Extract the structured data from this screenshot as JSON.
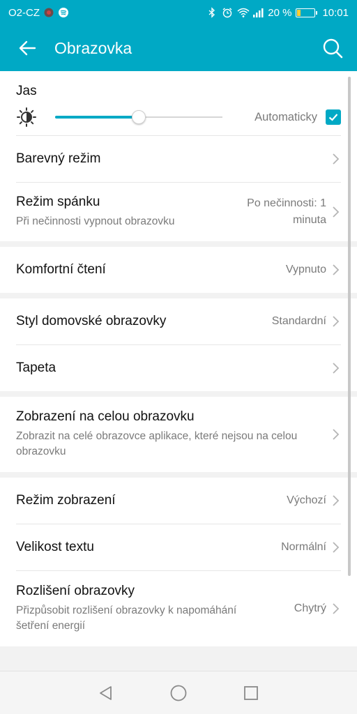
{
  "statusbar": {
    "carrier": "O2-CZ",
    "signal_text": "20 %",
    "time": "10:01",
    "battery_percent": 20
  },
  "appbar": {
    "title": "Obrazovka",
    "back_icon": "arrow-left-icon",
    "search_icon": "search-icon"
  },
  "brightness": {
    "title": "Jas",
    "level_percent": 50,
    "auto_label": "Automaticky",
    "auto_checked": true
  },
  "settings": [
    {
      "id": "color-mode",
      "title": "Barevný režim",
      "subtitle": "",
      "value": ""
    },
    {
      "id": "sleep",
      "title": "Režim spánku",
      "subtitle": "Při nečinnosti vypnout obrazovku",
      "value_lines": [
        "Po nečinnosti: 1",
        "minuta"
      ]
    },
    {
      "id": "comfort-reading",
      "title": "Komfortní čtení",
      "subtitle": "",
      "value": "Vypnuto"
    },
    {
      "id": "home-style",
      "title": "Styl domovské obrazovky",
      "subtitle": "",
      "value": "Standardní"
    },
    {
      "id": "wallpaper",
      "title": "Tapeta",
      "subtitle": "",
      "value": ""
    },
    {
      "id": "fullscreen",
      "title": "Zobrazení na celou obrazovku",
      "subtitle": "Zobrazit na celé obrazovce aplikace, které nejsou na celou obrazovku",
      "value": ""
    },
    {
      "id": "display-mode",
      "title": "Režim zobrazení",
      "subtitle": "",
      "value": "Výchozí"
    },
    {
      "id": "text-size",
      "title": "Velikost textu",
      "subtitle": "",
      "value": "Normální"
    },
    {
      "id": "resolution",
      "title": "Rozlišení obrazovky",
      "subtitle": "Přizpůsobit rozlišení obrazovky k napomáhání šetření energií",
      "value": "Chytrý"
    }
  ],
  "colors": {
    "accent": "#00a9c5",
    "background": "#f2f2f2"
  }
}
